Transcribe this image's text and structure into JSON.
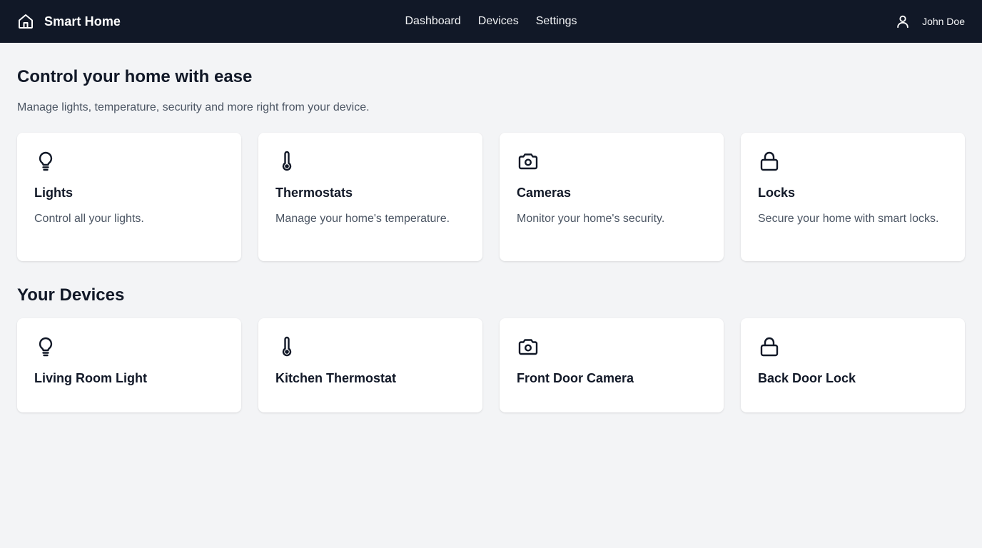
{
  "app": {
    "title": "Smart Home",
    "icon": "home-icon"
  },
  "nav": {
    "items": [
      {
        "label": "Dashboard"
      },
      {
        "label": "Devices"
      },
      {
        "label": "Settings"
      }
    ]
  },
  "user": {
    "name": "John Doe",
    "icon": "user-icon"
  },
  "hero": {
    "title": "Control your home with ease",
    "subtitle": "Manage lights, temperature, security and more right from your device."
  },
  "features": [
    {
      "icon": "lightbulb-icon",
      "title": "Lights",
      "description": "Control all your lights."
    },
    {
      "icon": "thermometer-icon",
      "title": "Thermostats",
      "description": "Manage your home's temperature."
    },
    {
      "icon": "camera-icon",
      "title": "Cameras",
      "description": "Monitor your home's security."
    },
    {
      "icon": "lock-icon",
      "title": "Locks",
      "description": "Secure your home with smart locks."
    }
  ],
  "devices": {
    "title": "Your Devices",
    "items": [
      {
        "icon": "lightbulb-icon",
        "name": "Living Room Light"
      },
      {
        "icon": "thermometer-icon",
        "name": "Kitchen Thermostat"
      },
      {
        "icon": "camera-icon",
        "name": "Front Door Camera"
      },
      {
        "icon": "lock-icon",
        "name": "Back Door Lock"
      }
    ]
  },
  "colors": {
    "topbar": "#111827",
    "background": "#f3f4f6",
    "card": "#ffffff",
    "text_primary": "#111827",
    "text_secondary": "#4b5563"
  }
}
